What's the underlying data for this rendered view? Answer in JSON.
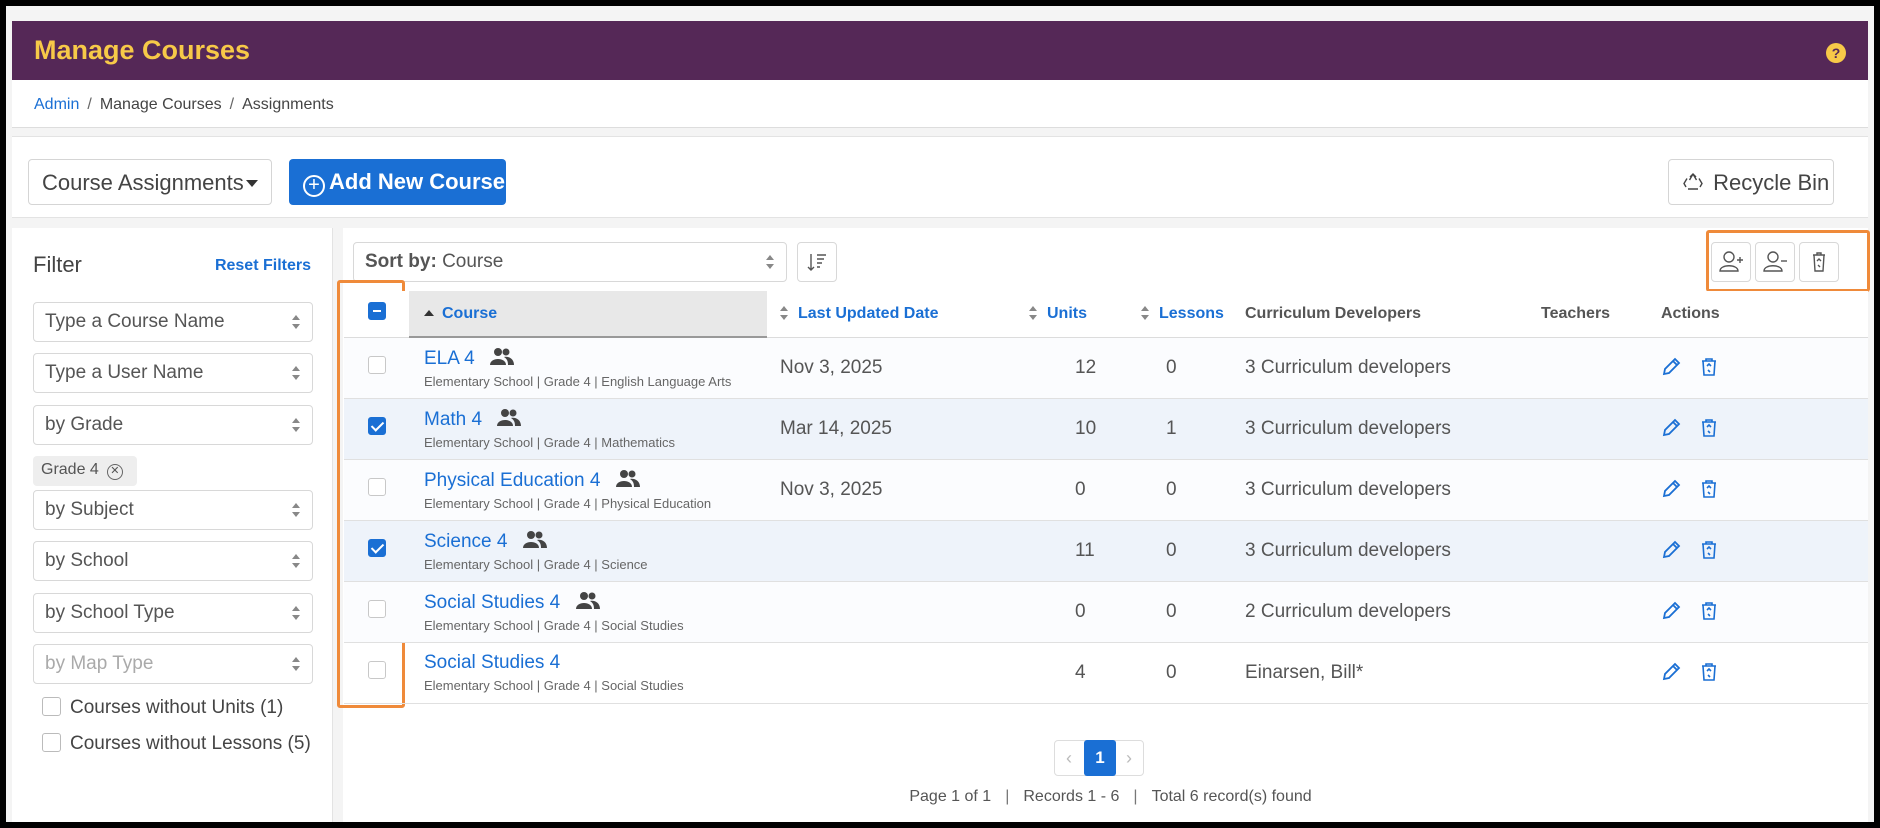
{
  "header": {
    "title": "Manage Courses",
    "help_label": "?"
  },
  "breadcrumb": {
    "root": "Admin",
    "middle": "Manage Courses",
    "current": "Assignments"
  },
  "toolbar": {
    "view_selector": "Course Assignments",
    "add_button": "Add New Course",
    "recycle_button": "Recycle Bin"
  },
  "filter": {
    "title": "Filter",
    "reset": "Reset Filters",
    "course_name": "Type a Course Name",
    "user_name": "Type a User Name",
    "grade": "by Grade",
    "grade_chip": "Grade 4",
    "subject": "by Subject",
    "school": "by School",
    "school_type": "by School Type",
    "map_type": "by Map Type",
    "no_units": "Courses without Units  (1)",
    "no_lessons": "Courses without Lessons  (5)"
  },
  "sort": {
    "label": "Sort by:",
    "value": "Course"
  },
  "table": {
    "headers": {
      "course": "Course",
      "updated": "Last Updated Date",
      "units": "Units",
      "lessons": "Lessons",
      "developers": "Curriculum Developers",
      "teachers": "Teachers",
      "actions": "Actions"
    },
    "rows": [
      {
        "name": "ELA 4",
        "sub": "Elementary School | Grade 4 | English Language Arts",
        "updated": "Nov 3, 2025",
        "units": "12",
        "lessons": "0",
        "developers": "3 Curriculum developers",
        "teachers": ""
      },
      {
        "name": "Math 4",
        "sub": "Elementary School | Grade 4 | Mathematics",
        "updated": "Mar 14, 2025",
        "units": "10",
        "lessons": "1",
        "developers": "3 Curriculum developers",
        "teachers": ""
      },
      {
        "name": "Physical Education 4",
        "sub": "Elementary School | Grade 4 | Physical Education",
        "updated": "Nov 3, 2025",
        "units": "0",
        "lessons": "0",
        "developers": "3 Curriculum developers",
        "teachers": ""
      },
      {
        "name": "Science 4",
        "sub": "Elementary School | Grade 4 | Science",
        "updated": "",
        "units": "11",
        "lessons": "0",
        "developers": "3 Curriculum developers",
        "teachers": ""
      },
      {
        "name": "Social Studies 4",
        "sub": "Elementary School | Grade 4 | Social Studies",
        "updated": "",
        "units": "0",
        "lessons": "0",
        "developers": "2 Curriculum developers",
        "teachers": ""
      },
      {
        "name": "Social Studies 4",
        "sub": "Elementary School | Grade 4 | Social Studies",
        "updated": "",
        "units": "4",
        "lessons": "0",
        "developers": "Einarsen, Bill*",
        "teachers": ""
      }
    ]
  },
  "pagination": {
    "prev": "‹",
    "current": "1",
    "next": "›",
    "page_info": "Page 1 of 1",
    "records": "Records 1 - 6",
    "total": "Total 6 record(s) found"
  },
  "colors": {
    "header_bg": "#552857",
    "header_title": "#f7c948",
    "accent": "#1a6fd4",
    "highlight": "#ef8a3a"
  }
}
